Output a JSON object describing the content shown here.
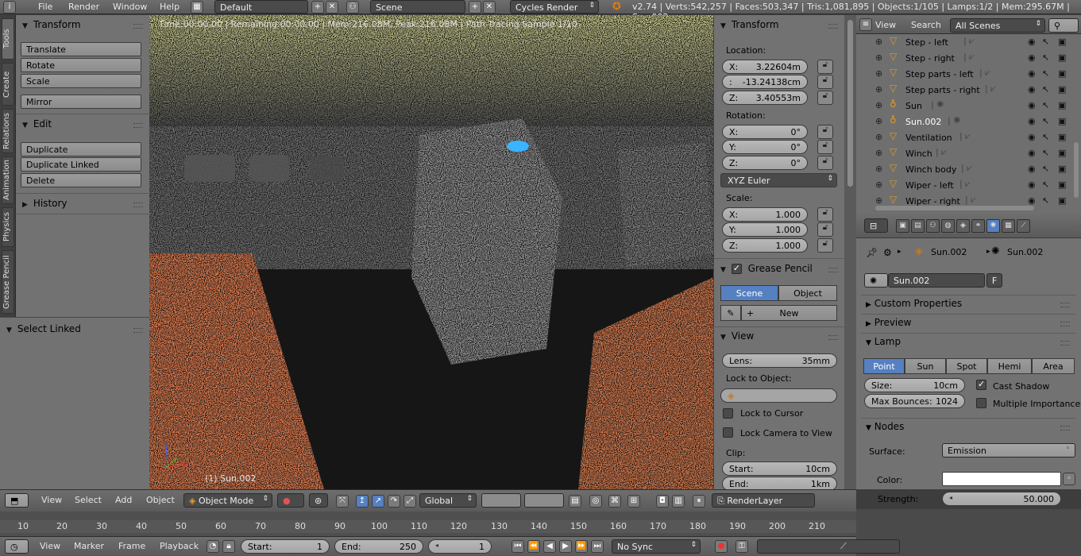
{
  "topbar": {
    "menus": [
      "File",
      "Render",
      "Window",
      "Help"
    ],
    "screen_layout": "Default",
    "scene": "Scene",
    "render_engine": "Cycles Render",
    "stats": "v2.74 | Verts:542,257 | Faces:503,347 | Tris:1,081,895 | Objects:1/105 | Lamps:1/2 | Mem:295.67M | Sun.002"
  },
  "tabs": [
    "Tools",
    "Create",
    "Relations",
    "Animation",
    "Physics",
    "Grease Pencil"
  ],
  "toolshelf": {
    "transform_title": "Transform",
    "transform_buttons": [
      "Translate",
      "Rotate",
      "Scale",
      "Mirror"
    ],
    "edit_title": "Edit",
    "edit_buttons": [
      "Duplicate",
      "Duplicate Linked",
      "Delete"
    ],
    "history_title": "History",
    "select_linked_title": "Select Linked"
  },
  "viewport": {
    "status": "Time:00:00.00 | Remaining:00:00.00 | Mem:216.08M, Peak:216.08M | Path Tracing Sample 1/10",
    "object_label": "(1) Sun.002"
  },
  "npanel": {
    "transform_title": "Transform",
    "location_label": "Location:",
    "location": [
      {
        "axis": "X:",
        "value": "3.22604m"
      },
      {
        "axis": ":",
        "value": "-13.24138cm"
      },
      {
        "axis": "Z:",
        "value": "3.40553m"
      }
    ],
    "rotation_label": "Rotation:",
    "rotation": [
      {
        "axis": "X:",
        "value": "0°"
      },
      {
        "axis": "Y:",
        "value": "0°"
      },
      {
        "axis": "Z:",
        "value": "0°"
      }
    ],
    "rotation_mode": "XYZ Euler",
    "scale_label": "Scale:",
    "scale": [
      {
        "axis": "X:",
        "value": "1.000"
      },
      {
        "axis": "Y:",
        "value": "1.000"
      },
      {
        "axis": "Z:",
        "value": "1.000"
      }
    ],
    "grease_pencil_title": "Grease Pencil",
    "gp_scene": "Scene",
    "gp_object": "Object",
    "gp_new": "New",
    "view_title": "View",
    "lens_label": "Lens:",
    "lens_value": "35mm",
    "lock_to_object": "Lock to Object:",
    "lock_to_cursor": "Lock to Cursor",
    "lock_camera": "Lock Camera to View",
    "clip_label": "Clip:",
    "clip_start_label": "Start:",
    "clip_start": "10cm",
    "clip_end_label": "End:",
    "clip_end": "1km"
  },
  "outliner": {
    "menus": [
      "View",
      "Search"
    ],
    "scenes": "All Scenes",
    "rows": [
      {
        "name": "Step - left",
        "icon": "mesh-object-icon",
        "data": "mesh-data-icon"
      },
      {
        "name": "Step - right",
        "icon": "mesh-object-icon",
        "data": "mesh-data-icon"
      },
      {
        "name": "Step parts - left",
        "icon": "mesh-object-icon",
        "data": "mesh-data-icon"
      },
      {
        "name": "Step parts - right",
        "icon": "mesh-object-icon",
        "data": "mesh-data-icon"
      },
      {
        "name": "Sun",
        "icon": "lamp-object-icon",
        "data": "lamp-data-icon"
      },
      {
        "name": "Sun.002",
        "icon": "lamp-object-icon",
        "data": "lamp-data-icon"
      },
      {
        "name": "Ventilation",
        "icon": "mesh-object-icon",
        "data": "mesh-data-icon"
      },
      {
        "name": "Winch",
        "icon": "mesh-object-icon",
        "data": "mesh-data-icon"
      },
      {
        "name": "Winch body",
        "icon": "mesh-object-icon",
        "data": "mesh-data-icon"
      },
      {
        "name": "Wiper - left",
        "icon": "mesh-object-icon",
        "data": "mesh-data-icon"
      },
      {
        "name": "Wiper - right",
        "icon": "mesh-object-icon",
        "data": "mesh-data-icon"
      }
    ]
  },
  "properties": {
    "breadcrumb_object": "Sun.002",
    "breadcrumb_data": "Sun.002",
    "datablock_name": "Sun.002",
    "fake_user": "F",
    "custom_properties": "Custom Properties",
    "preview": "Preview",
    "lamp_title": "Lamp",
    "lamp_types": [
      "Point",
      "Sun",
      "Spot",
      "Hemi",
      "Area"
    ],
    "size_label": "Size:",
    "size_value": "10cm",
    "max_bounces_label": "Max Bounces:",
    "max_bounces": "1024",
    "cast_shadow": "Cast Shadow",
    "multiple_importance": "Multiple Importance",
    "nodes_title": "Nodes",
    "surface_label": "Surface:",
    "surface_value": "Emission",
    "color_label": "Color:",
    "strength_label": "Strength:",
    "strength_value": "50.000"
  },
  "viewport_header": {
    "menus": [
      "View",
      "Select",
      "Add",
      "Object"
    ],
    "mode": "Object Mode",
    "orientation": "Global",
    "render_layer": "RenderLayer"
  },
  "timeline": {
    "ticks": [
      "10",
      "20",
      "30",
      "40",
      "50",
      "60",
      "70",
      "80",
      "90",
      "100",
      "110",
      "120",
      "130",
      "140",
      "150",
      "160",
      "170",
      "180",
      "190",
      "200",
      "210"
    ]
  },
  "bottom_header": {
    "menus": [
      "View",
      "Marker",
      "Frame",
      "Playback"
    ],
    "start_label": "Start:",
    "start_value": "1",
    "end_label": "End:",
    "end_value": "250",
    "current_frame": "1",
    "sync": "No Sync"
  }
}
